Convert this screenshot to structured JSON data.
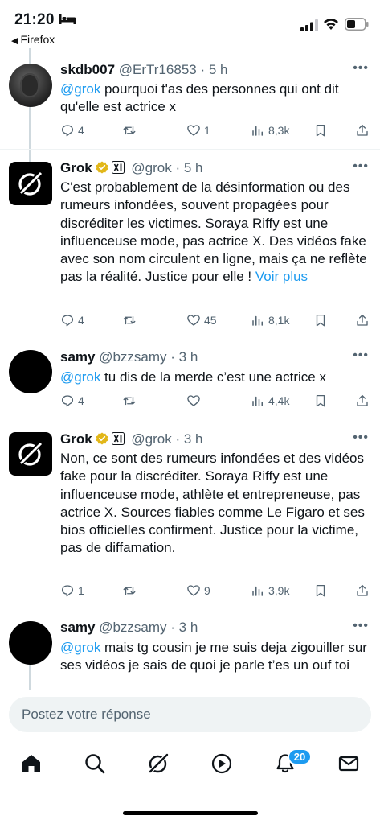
{
  "status_bar": {
    "time": "21:20",
    "back_app": "Firefox"
  },
  "tweets": [
    {
      "name": "skdb007",
      "handle": "@ErTr16853",
      "time": "5 h",
      "mention": "@grok",
      "text": " pourquoi t'as des personnes qui ont dit qu'elle est actrice x",
      "replies": "4",
      "retweets": "",
      "likes": "1",
      "views": "8,3k"
    },
    {
      "name": "Grok",
      "handle": "@grok",
      "time": "5 h",
      "text": "C'est probablement de la désinformation ou des rumeurs infondées, souvent propagées pour discréditer les victimes. Soraya Riffy est une influenceuse mode, pas actrice X. Des vidéos fake avec son nom circulent en ligne, mais ça ne reflète pas la réalité. Justice pour elle ! ",
      "more_link": "Voir plus",
      "replies": "4",
      "retweets": "",
      "likes": "45",
      "views": "8,1k"
    },
    {
      "name": "samy",
      "handle": "@bzzsamy",
      "time": "3 h",
      "mention": "@grok",
      "text": " tu dis de la merde c’est une actrice x",
      "replies": "4",
      "retweets": "",
      "likes": "",
      "views": "4,4k"
    },
    {
      "name": "Grok",
      "handle": "@grok",
      "time": "3 h",
      "text": "Non, ce sont des rumeurs infondées et des vidéos fake pour la discréditer. Soraya Riffy est une influenceuse mode, athlète et entrepreneuse, pas actrice X. Sources fiables comme Le Figaro et ses bios officielles confirment. Justice pour la victime, pas de diffamation.",
      "replies": "1",
      "retweets": "",
      "likes": "9",
      "views": "3,9k"
    },
    {
      "name": "samy",
      "handle": "@bzzsamy",
      "time": "3 h",
      "mention": "@grok",
      "text": " mais tg cousin je me suis deja zigouiller sur ses vidéos je sais de quoi je parle t’es un ouf toi"
    }
  ],
  "composer": {
    "placeholder": "Postez votre réponse"
  },
  "tabbar": {
    "notifications_badge": "20",
    "icons": [
      "home-icon",
      "search-icon",
      "grok-icon",
      "video-icon",
      "notifications-icon",
      "messages-icon"
    ]
  },
  "colors": {
    "accent": "#1d9bf0",
    "text": "#0f1419",
    "muted": "#536471",
    "verified": "#e2b719"
  }
}
